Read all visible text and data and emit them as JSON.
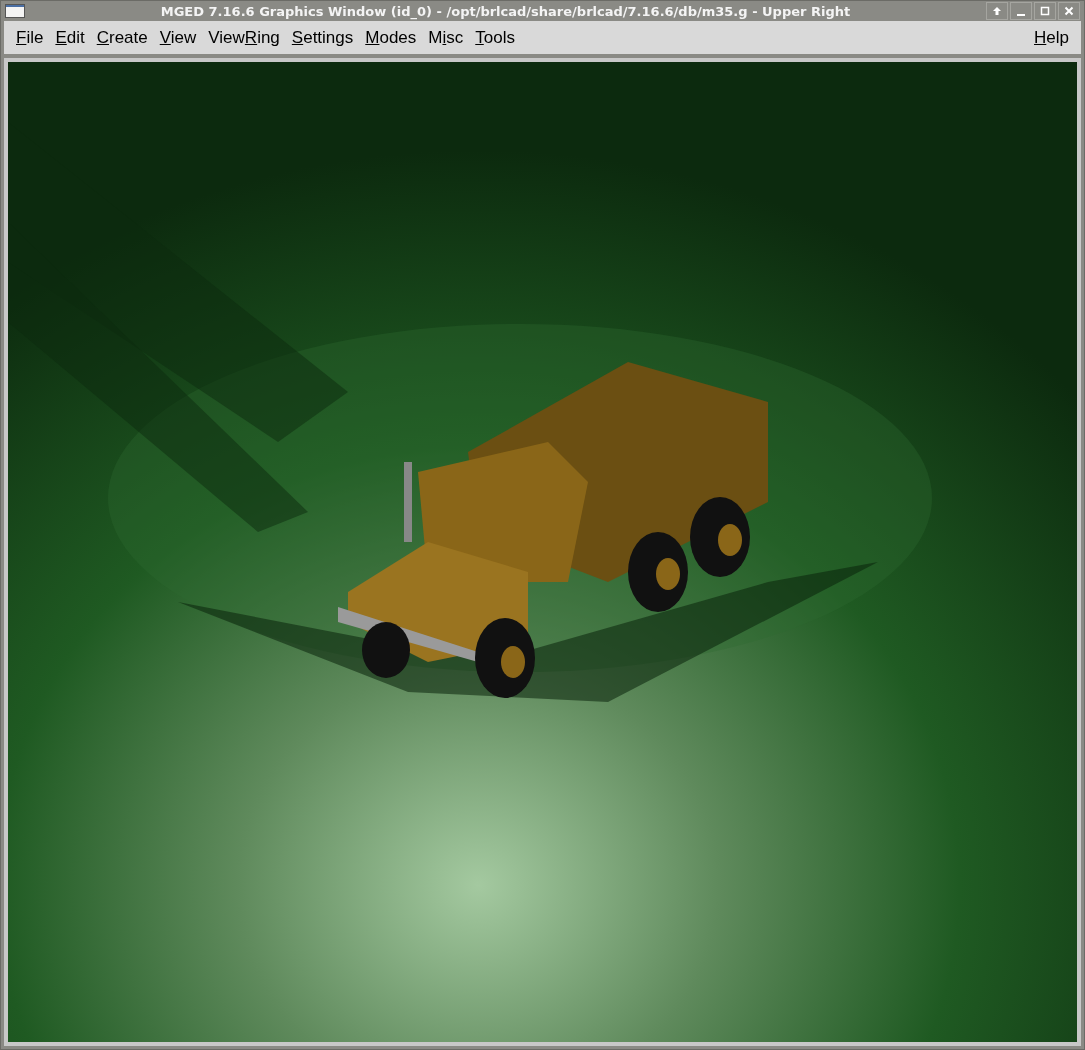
{
  "window": {
    "title": "MGED 7.16.6 Graphics Window (id_0) - /opt/brlcad/share/brlcad/7.16.6/db/m35.g - Upper Right"
  },
  "menu": [
    {
      "key": "F",
      "after": "ile"
    },
    {
      "key": "E",
      "after": "dit"
    },
    {
      "key": "C",
      "after": "reate"
    },
    {
      "key": "V",
      "after": "iew"
    },
    {
      "before": "View",
      "key": "R",
      "after": "ing"
    },
    {
      "key": "S",
      "after": "ettings"
    },
    {
      "key": "M",
      "after": "odes"
    },
    {
      "before": "M",
      "key": "i",
      "after": "sc"
    },
    {
      "key": "T",
      "after": "ools"
    }
  ],
  "help_menu": {
    "key": "H",
    "after": "elp"
  }
}
